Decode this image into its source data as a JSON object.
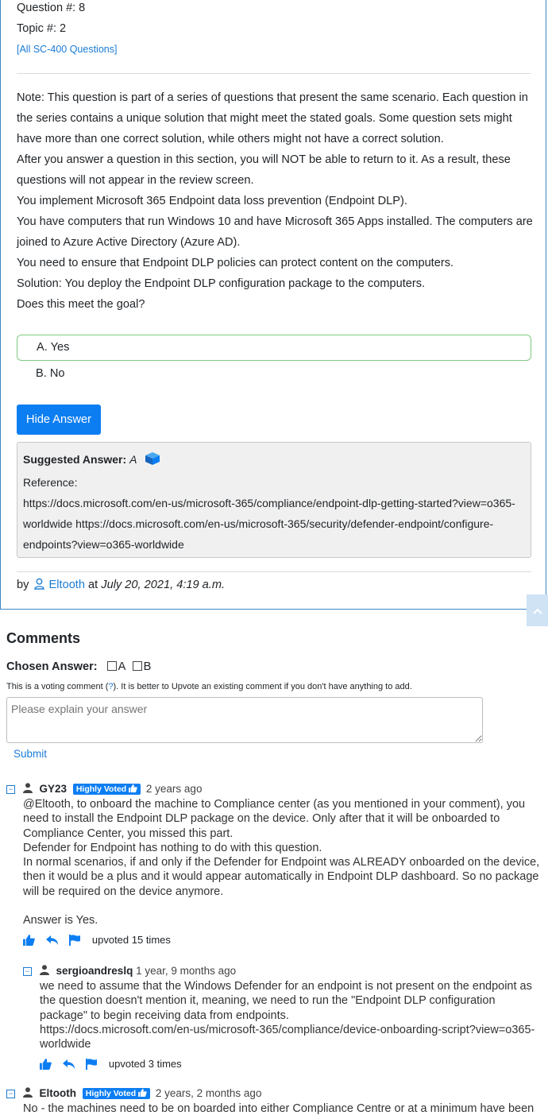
{
  "question": {
    "number_label": "Question #: 8",
    "topic_label": "Topic #: 2",
    "all_link": "[All SC-400 Questions]",
    "paragraphs": [
      "Note: This question is part of a series of questions that present the same scenario. Each question in the series contains a unique solution that might meet the stated goals. Some question sets might have more than one correct solution, while others might not have a correct solution.",
      "After you answer a question in this section, you will NOT be able to return to it. As a result, these questions will not appear in the review screen.",
      "You implement Microsoft 365 Endpoint data loss prevention (Endpoint DLP).",
      "You have computers that run Windows 10 and have Microsoft 365 Apps installed. The computers are joined to Azure Active Directory (Azure AD).",
      "You need to ensure that Endpoint DLP policies can protect content on the computers.",
      "Solution: You deploy the Endpoint DLP configuration package to the computers.",
      "Does this meet the goal?"
    ],
    "choices": [
      "A. Yes",
      "B. No"
    ],
    "hide_button": "Hide Answer",
    "suggested_label": "Suggested Answer:",
    "suggested_value": "A",
    "reference_label": "Reference:",
    "reference_text": "https://docs.microsoft.com/en-us/microsoft-365/compliance/endpoint-dlp-getting-started?view=o365-worldwide https://docs.microsoft.com/en-us/microsoft-365/security/defender-endpoint/configure-endpoints?view=o365-worldwide",
    "by": "by",
    "author": "Eltooth",
    "at": "at",
    "date": "July 20, 2021, 4:19 a.m."
  },
  "comments_section": {
    "title": "Comments",
    "chosen_label": "Chosen Answer:",
    "option_a": "A",
    "option_b": "B",
    "voting_note_pre": "This is a voting comment (",
    "voting_note_q": "?",
    "voting_note_post": "). It is better to Upvote an existing comment if you don't have anything to add.",
    "placeholder": "Please explain your answer",
    "submit": "Submit"
  },
  "comments": [
    {
      "user": "GY23",
      "badge": "Highly Voted",
      "ago": "2 years ago",
      "paragraphs": [
        "@Eltooth, to onboard the machine to Compliance center (as you mentioned in your comment), you need to install the Endpoint DLP package on the device. Only after that it will be onboarded to Compliance Center, you missed this part.",
        "Defender for Endpoint has nothing to do with this question.",
        "In normal scenarios, if and only if the Defender for Endpoint was ALREADY onboarded on the device, then it would be a plus and it would appear automatically in Endpoint DLP dashboard. So no package will be required on the device anymore.",
        "",
        "Answer is Yes."
      ],
      "upvotes": "upvoted 15 times"
    },
    {
      "user": "sergioandreslq",
      "ago": "1 year, 9 months ago",
      "paragraphs": [
        "we need to assume that the Windows Defender for an endpoint is not present on the endpoint as the question doesn't mention it, meaning, we need to run the \"Endpoint DLP configuration package\" to begin receiving data from endpoints.",
        "https://docs.microsoft.com/en-us/microsoft-365/compliance/device-onboarding-script?view=o365-worldwide"
      ],
      "upvotes": "upvoted 3 times"
    },
    {
      "user": "Eltooth",
      "badge": "Highly Voted",
      "ago": "2 years, 2 months ago",
      "paragraphs": [
        "No - the machines need to be on boarded into either Compliance Centre or at a minimum have been"
      ]
    }
  ],
  "colors": {
    "accent": "#0d7ef2",
    "link": "#1a7bd4",
    "card_border": "#3d87c4",
    "correct_border": "#7fcc7f"
  }
}
